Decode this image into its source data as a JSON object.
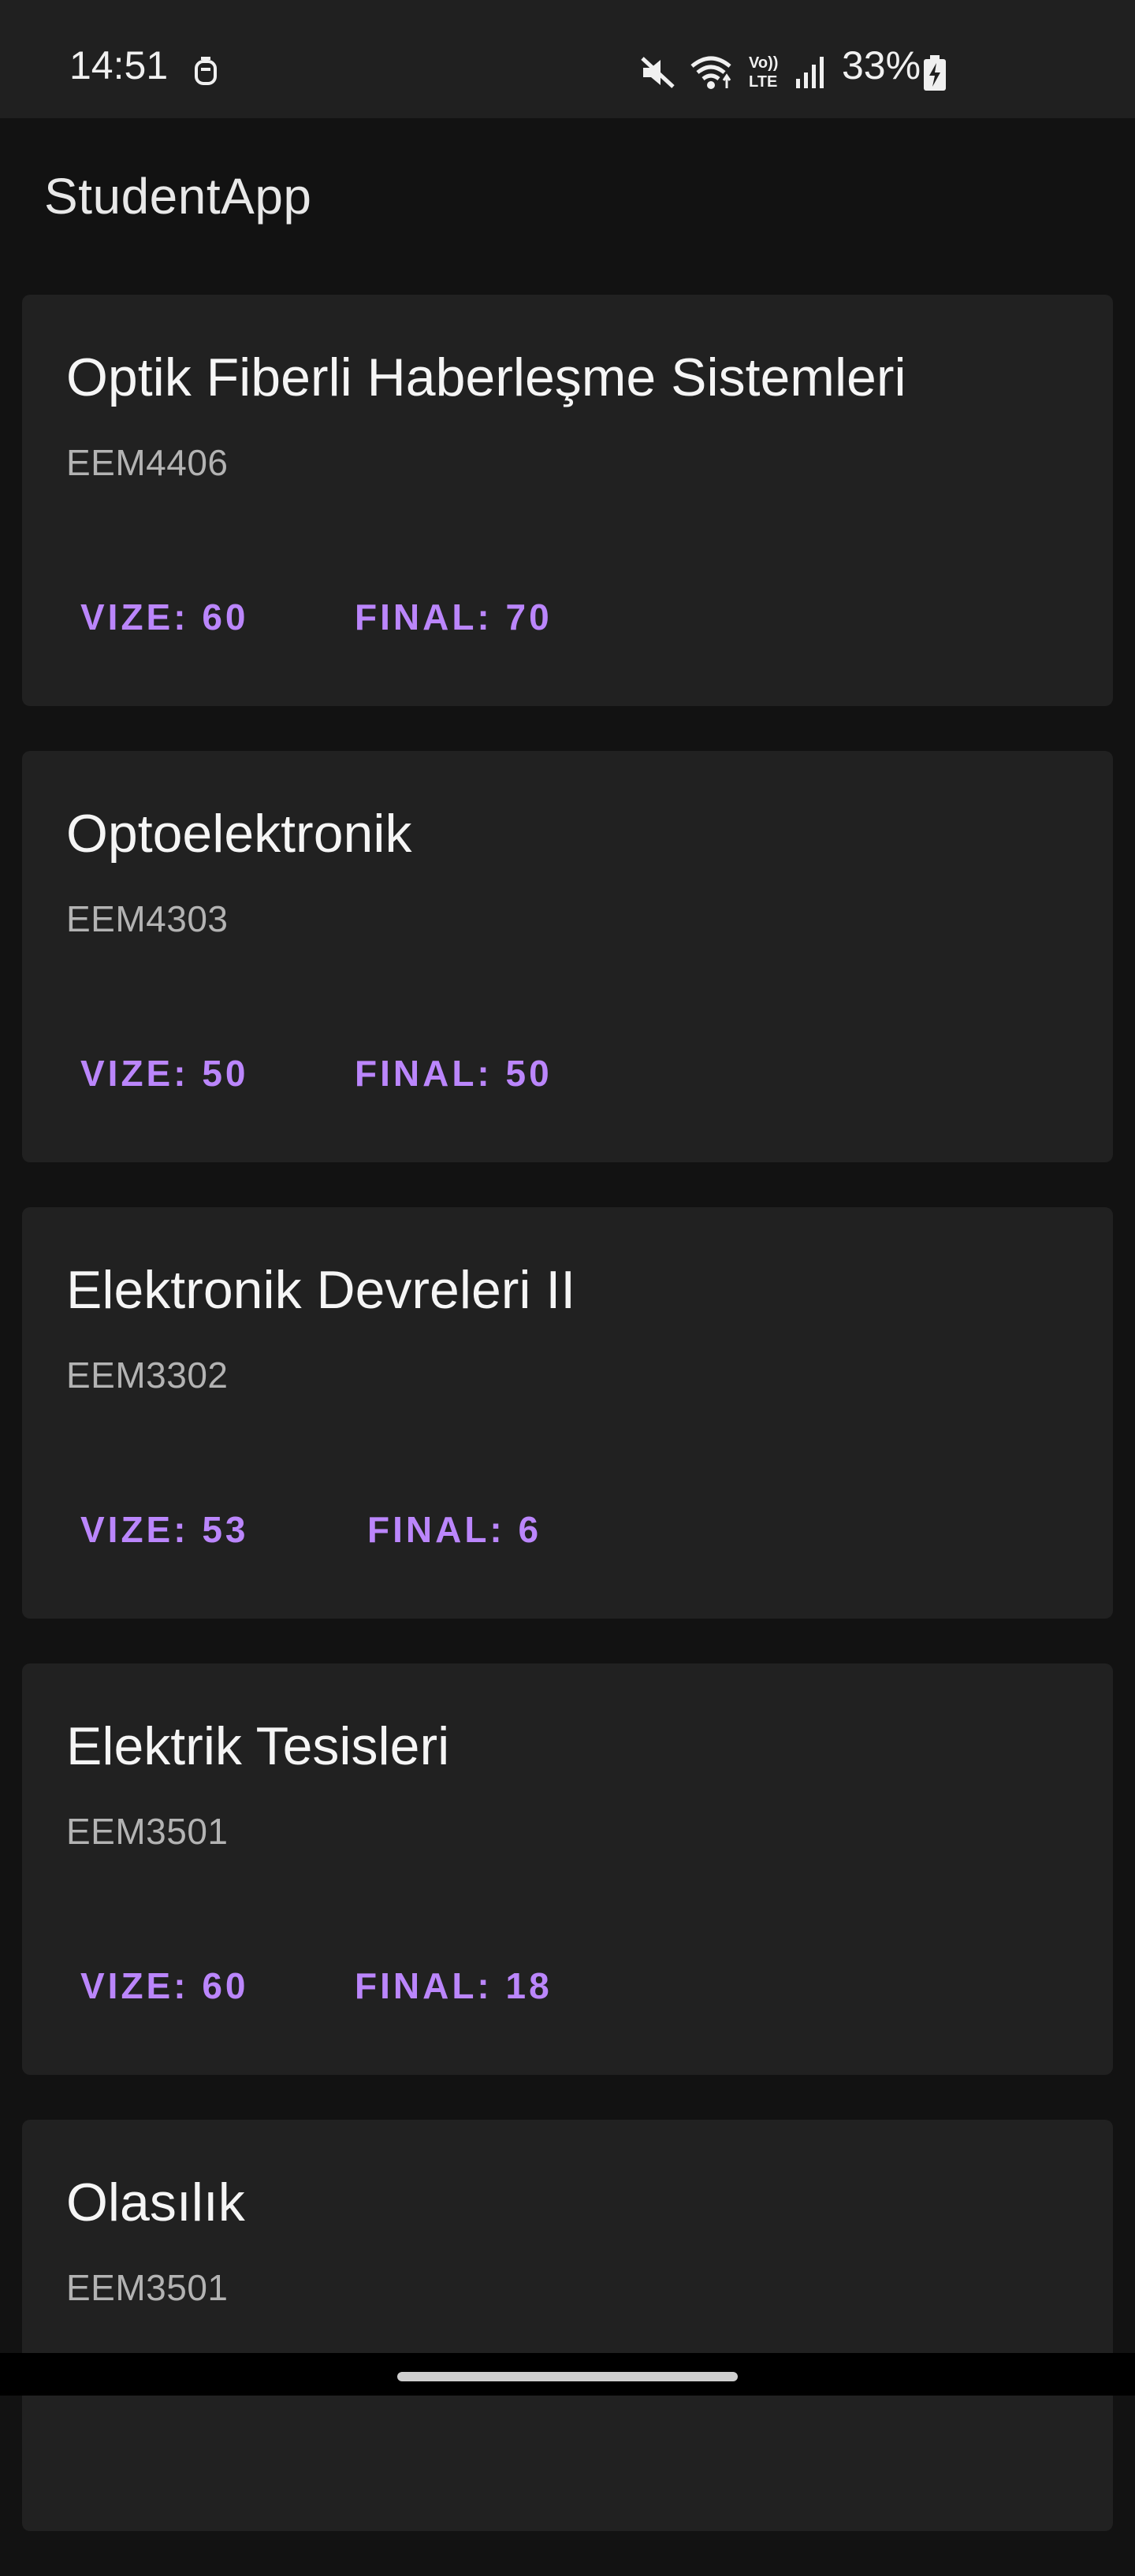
{
  "status_bar": {
    "time": "14:51",
    "battery": "33%",
    "icons": [
      "notification-icon",
      "mute-icon",
      "wifi-icon",
      "volte-icon",
      "signal-icon",
      "battery-charging-icon"
    ]
  },
  "app_bar": {
    "title": "StudentApp"
  },
  "courses": [
    {
      "name": "Optik Fiberli Haberleşme Sistemleri",
      "code": "EEM4406",
      "vize": "VIZE: 60",
      "final": "FINAL: 70"
    },
    {
      "name": "Optoelektronik",
      "code": "EEM4303",
      "vize": "VIZE: 50",
      "final": "FINAL: 50"
    },
    {
      "name": "Elektronik Devreleri II",
      "code": "EEM3302",
      "vize": "VIZE: 53",
      "final": "FINAL: 6"
    },
    {
      "name": "Elektrik Tesisleri",
      "code": "EEM3501",
      "vize": "VIZE: 60",
      "final": "FINAL: 18"
    },
    {
      "name": "Olasılık",
      "code": "EEM3501"
    }
  ],
  "colors": {
    "accent": "#bb86fc",
    "background": "#121212",
    "card": "#212121",
    "status_bar": "#202020"
  }
}
